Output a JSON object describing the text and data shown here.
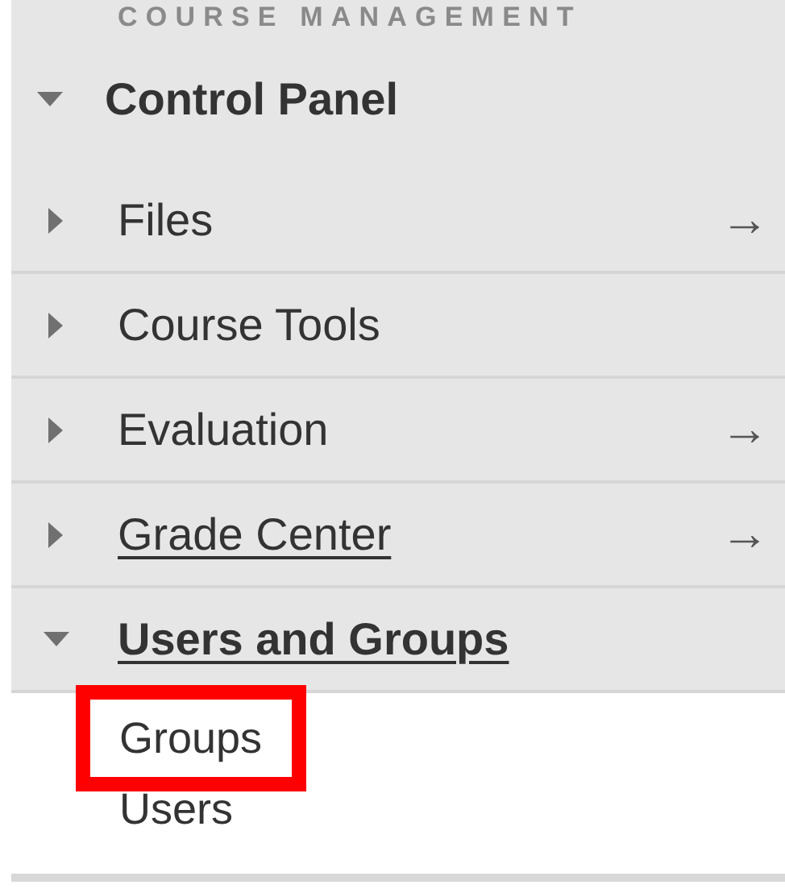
{
  "section_title": "COURSE MANAGEMENT",
  "control_panel": {
    "label": "Control Panel",
    "expanded": true
  },
  "items": [
    {
      "label": "Files",
      "expanded": false,
      "link": false,
      "selected": false,
      "arrow": "→"
    },
    {
      "label": "Course Tools",
      "expanded": false,
      "link": false,
      "selected": false
    },
    {
      "label": "Evaluation",
      "expanded": false,
      "link": false,
      "selected": false,
      "arrow": "→"
    },
    {
      "label": "Grade Center",
      "expanded": false,
      "link": true,
      "selected": false,
      "arrow": "→"
    },
    {
      "label": "Users and Groups",
      "expanded": true,
      "link": true,
      "selected": true
    }
  ],
  "subitems": [
    {
      "label": "Groups",
      "highlighted": true
    },
    {
      "label": "Users",
      "highlighted": false
    }
  ]
}
